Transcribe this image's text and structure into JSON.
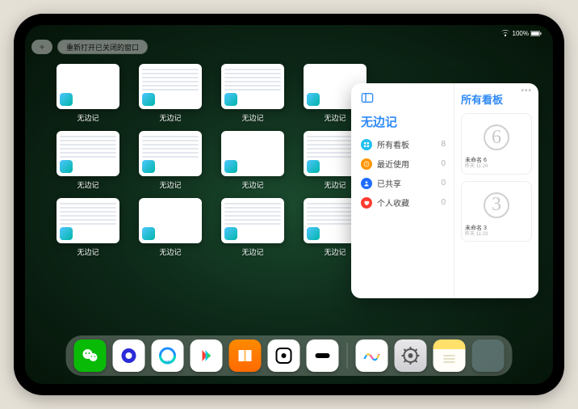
{
  "statusbar": {
    "signal": "wifi",
    "battery": "100%"
  },
  "topbar": {
    "add_label": "+",
    "reopen_label": "重新打开已关闭的窗口"
  },
  "windows": [
    {
      "label": "无边记",
      "style": "blank"
    },
    {
      "label": "无边记",
      "style": "cal"
    },
    {
      "label": "无边记",
      "style": "cal"
    },
    {
      "label": "无边记",
      "style": "blank"
    },
    {
      "label": "无边记",
      "style": "cal"
    },
    {
      "label": "无边记",
      "style": "cal"
    },
    {
      "label": "无边记",
      "style": "blank"
    },
    {
      "label": "无边记",
      "style": "cal"
    },
    {
      "label": "无边记",
      "style": "cal"
    },
    {
      "label": "无边记",
      "style": "blank"
    },
    {
      "label": "无边记",
      "style": "cal"
    },
    {
      "label": "无边记",
      "style": "cal"
    }
  ],
  "panel": {
    "left_title": "无边记",
    "right_title": "所有看板",
    "menu": [
      {
        "icon": "grid",
        "color": "c-blue",
        "label": "所有看板",
        "count": "8"
      },
      {
        "icon": "clock",
        "color": "c-orange",
        "label": "最近使用",
        "count": "0"
      },
      {
        "icon": "person",
        "color": "c-navy",
        "label": "已共享",
        "count": "0"
      },
      {
        "icon": "heart",
        "color": "c-red",
        "label": "个人收藏",
        "count": "0"
      }
    ],
    "boards": [
      {
        "glyph": "6",
        "name": "未命名 6",
        "sub": "昨天 11:24"
      },
      {
        "glyph": "3",
        "name": "未命名 3",
        "sub": "昨天 11:23"
      }
    ]
  },
  "dock": {
    "apps": [
      {
        "name": "wechat-icon"
      },
      {
        "name": "quark-icon"
      },
      {
        "name": "qq-browser-icon"
      },
      {
        "name": "youku-icon"
      },
      {
        "name": "books-icon"
      },
      {
        "name": "obsidian-icon"
      },
      {
        "name": "iina-icon"
      },
      {
        "name": "freeform-icon"
      },
      {
        "name": "settings-icon"
      },
      {
        "name": "notes-icon"
      }
    ]
  }
}
